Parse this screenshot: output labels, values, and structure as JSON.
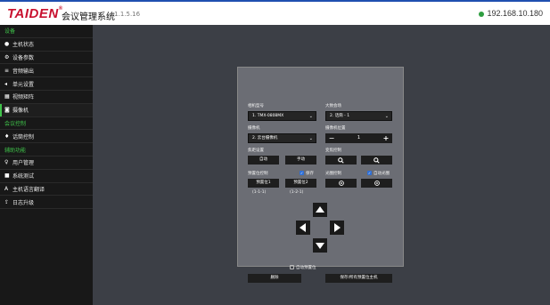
{
  "header": {
    "logo": "TAIDEN",
    "title": "会议管理系统",
    "version": "v1.1.5.16",
    "ip": "192.168.10.180"
  },
  "sidebar": {
    "sections": [
      {
        "title": "设备",
        "items": [
          {
            "label": "主机状态",
            "icon": "info-circle-icon"
          },
          {
            "label": "设备参数",
            "icon": "sliders-icon"
          },
          {
            "label": "音频输出",
            "icon": "equalizer-icon"
          },
          {
            "label": "单元设置",
            "icon": "speaker-icon"
          },
          {
            "label": "视频矩阵",
            "icon": "grid-icon"
          },
          {
            "label": "摄像机",
            "icon": "camera-icon",
            "active": true
          }
        ]
      },
      {
        "title": "会议控制",
        "items": [
          {
            "label": "话筒控制",
            "icon": "microphone-icon"
          }
        ]
      },
      {
        "title": "辅助功能",
        "items": [
          {
            "label": "用户管理",
            "icon": "user-pin-icon"
          },
          {
            "label": "系统测试",
            "icon": "flask-icon"
          },
          {
            "label": "主机语言翻译",
            "icon": "language-icon"
          },
          {
            "label": "日志升级",
            "icon": "upload-icon"
          }
        ]
      }
    ]
  },
  "camera_panel": {
    "camera_model_label": "相机型号",
    "camera_model_value": "1. TMX-0808MX",
    "channel_label": "大致会场",
    "channel_value": "2. 话筒 - 1",
    "camera_label": "摄像机",
    "camera_value": "2. 云台摄像机",
    "preset_label": "摄像机位置",
    "preset_value": "1",
    "preset_minus": "−",
    "preset_plus": "+",
    "focus_label": "焦距设置",
    "focus_far": "自动",
    "focus_near": "手动",
    "zoom_label": "变焦控制",
    "zoom_in_icon": "zoom-in-icon",
    "zoom_out_icon": "zoom-out-icon",
    "position_label": "预置位控制",
    "position_check_label": "保存",
    "position_check": true,
    "aperture_label": "光圈控制",
    "aperture_check_label": "自动光圈",
    "aperture_check": true,
    "pos_btn1": "预置位1",
    "pos_btn2": "预置位2",
    "pos_sub1": "(1-1-1)",
    "pos_sub2": "(1-2-1)",
    "extra_check_label": "自动预置位",
    "extra_check": false,
    "btn_delete": "删除",
    "btn_save_all": "保存/所有预置位主机"
  }
}
